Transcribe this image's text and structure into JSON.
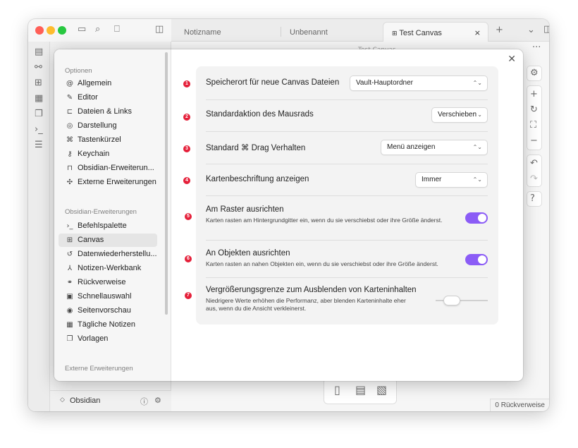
{
  "tabs": [
    {
      "label": "Notizname"
    },
    {
      "label": "Unbenannt"
    },
    {
      "label": "Test Canvas"
    }
  ],
  "canvas_header_title": "Test Canvas",
  "vault_name": "Obsidian",
  "status_bar": "0 Rückverweise",
  "settings": {
    "groups": {
      "options": "Optionen",
      "core_plugins": "Obsidian-Erweiterungen",
      "community_plugins": "Externe Erweiterungen"
    },
    "options_items": [
      {
        "label": "Allgemein",
        "icon": "at-icon"
      },
      {
        "label": "Editor",
        "icon": "pencil-icon"
      },
      {
        "label": "Dateien & Links",
        "icon": "folder-link-icon"
      },
      {
        "label": "Darstellung",
        "icon": "palette-icon"
      },
      {
        "label": "Tastenkürzel",
        "icon": "command-icon"
      },
      {
        "label": "Keychain",
        "icon": "key-icon"
      },
      {
        "label": "Obsidian-Erweiterun...",
        "icon": "folder-icon"
      },
      {
        "label": "Externe Erweiterungen",
        "icon": "puzzle-icon"
      }
    ],
    "plugin_items": [
      {
        "label": "Befehlspalette",
        "icon": "terminal-icon"
      },
      {
        "label": "Canvas",
        "icon": "canvas-icon",
        "selected": true
      },
      {
        "label": "Datenwiederherstellu...",
        "icon": "history-icon"
      },
      {
        "label": "Notizen-Werkbank",
        "icon": "workbench-icon"
      },
      {
        "label": "Rückverweise",
        "icon": "backlink-icon"
      },
      {
        "label": "Schnellauswahl",
        "icon": "switcher-icon"
      },
      {
        "label": "Seitenvorschau",
        "icon": "preview-icon"
      },
      {
        "label": "Tägliche Notizen",
        "icon": "calendar-icon"
      },
      {
        "label": "Vorlagen",
        "icon": "template-icon"
      }
    ],
    "rows": [
      {
        "badge": "1",
        "name": "Speicherort für neue Canvas Dateien",
        "value": "Vault-Hauptordner"
      },
      {
        "badge": "2",
        "name": "Standardaktion des Mausrads",
        "value": "Verschieben"
      },
      {
        "badge": "3",
        "name": "Standard ⌘ Drag Verhalten",
        "value": "Menü anzeigen"
      },
      {
        "badge": "4",
        "name": "Kartenbeschriftung anzeigen",
        "value": "Immer"
      },
      {
        "badge": "5",
        "name": "Am Raster ausrichten",
        "desc": "Karten rasten am Hintergrundgitter ein, wenn du sie verschiebst oder ihre Größe änderst.",
        "enabled": true
      },
      {
        "badge": "6",
        "name": "An Objekten ausrichten",
        "desc": "Karten rasten an nahen Objekten ein, wenn du sie verschiebst oder ihre Größe änderst.",
        "enabled": true
      },
      {
        "badge": "7",
        "name": "Vergrößerungsgrenze zum Ausblenden von Karteninhalten",
        "desc": "Niedrigere Werte erhöhen die Performanz, aber blenden Karteninhalte eher aus, wenn du die Ansicht verkleinerst.",
        "slider_fraction": 0.22
      }
    ]
  },
  "colors": {
    "accent": "#8b5cf6",
    "badge": "#e5203a"
  }
}
